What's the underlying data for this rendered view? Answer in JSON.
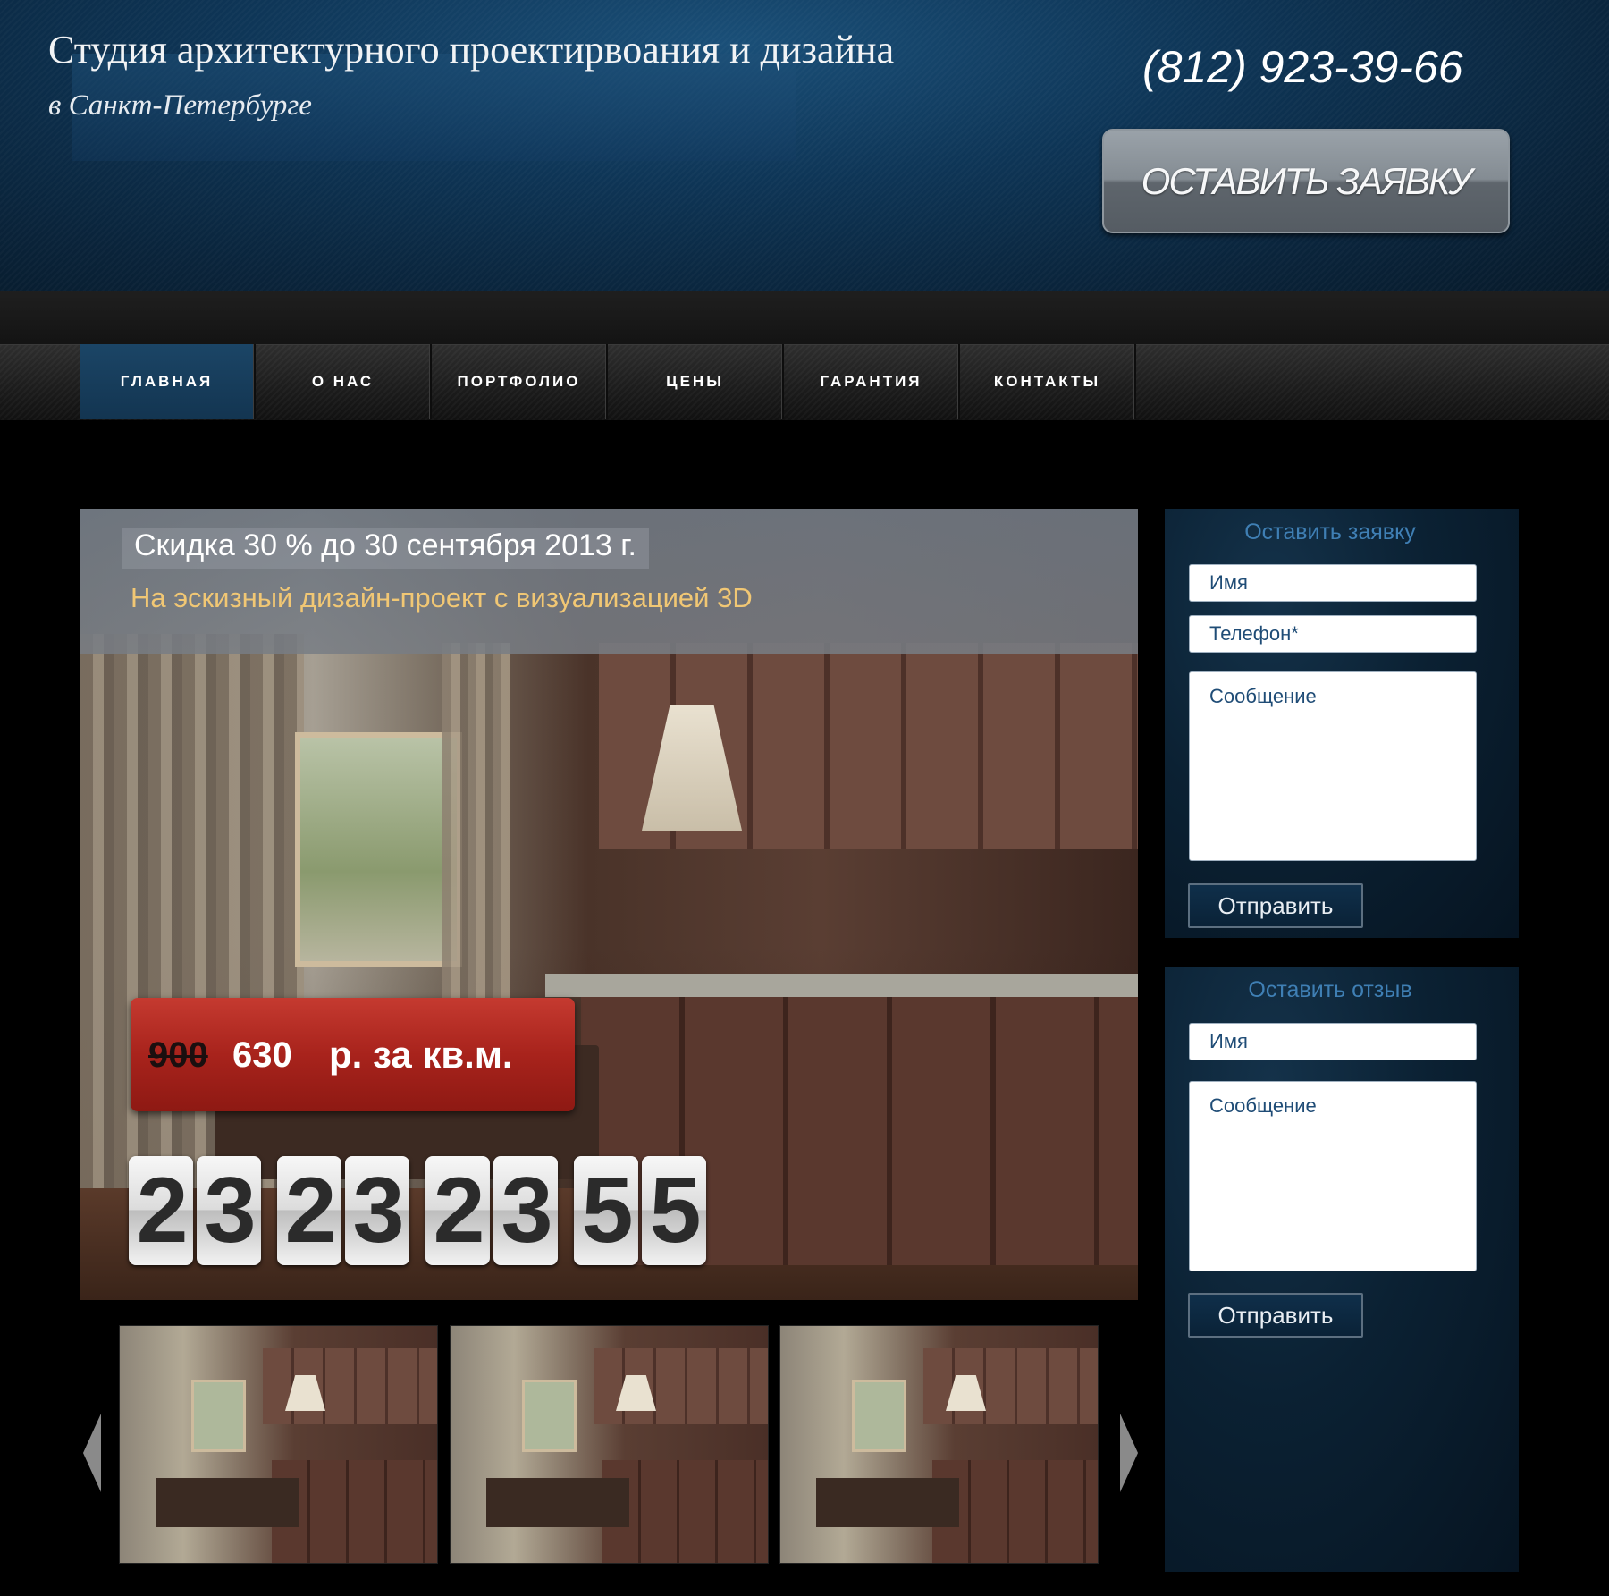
{
  "header": {
    "title": "Студия архитектурного проектирвоания и дизайна",
    "subtitle": "в Санкт-Петербурге",
    "phone": "(812) 923-39-66",
    "order_button": "ОСТАВИТЬ ЗАЯВКУ"
  },
  "nav": {
    "items": [
      {
        "label": "ГЛАВНАЯ"
      },
      {
        "label": "О НАС"
      },
      {
        "label": "ПОРТФОЛИО"
      },
      {
        "label": "ЦЕНЫ"
      },
      {
        "label": "ГАРАНТИЯ"
      },
      {
        "label": "КОНТАКТЫ"
      }
    ],
    "active": "ГЛАВНАЯ"
  },
  "hero": {
    "promo_title": "Скидка 30 % до 30 сентября 2013 г.",
    "promo_subtitle": "На эскизный дизайн-проект с визуализацией 3D",
    "old_price": "900",
    "new_price": "630",
    "unit": "р. за кв.м.",
    "countdown": {
      "groups": [
        {
          "d1": "2",
          "d2": "3"
        },
        {
          "d1": "2",
          "d2": "3"
        },
        {
          "d1": "2",
          "d2": "3"
        },
        {
          "d1": "5",
          "d2": "5"
        }
      ]
    }
  },
  "gallery": {
    "prev_icon": "triangle-left-icon",
    "next_icon": "triangle-right-icon",
    "thumb_count": 3
  },
  "request_form": {
    "title": "Оставить заявку",
    "name_placeholder": "Имя",
    "phone_placeholder": "Телефон*",
    "message_placeholder": "Сообщение",
    "submit": "Отправить"
  },
  "review_form": {
    "title": "Оставить отзыв",
    "name_placeholder": "Имя",
    "message_placeholder": "Сообщение",
    "submit": "Отправить"
  },
  "colors": {
    "header_blue": "#0e3556",
    "nav_active": "#1b4566",
    "promo_yellow": "#f1c774",
    "price_red": "#a8231c",
    "form_title_blue": "#3f7fb4"
  }
}
